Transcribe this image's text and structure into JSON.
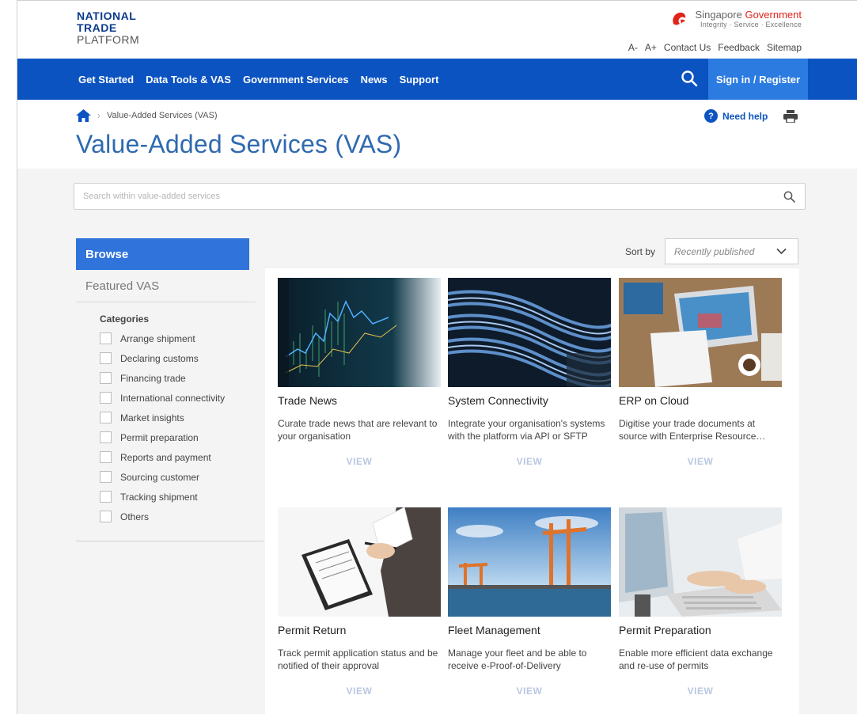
{
  "header": {
    "logo_lines": [
      "NATIONAL",
      "TRADE",
      "PLATFORM"
    ],
    "gov_prefix": "Singapore",
    "gov_suffix": "Government",
    "gov_tagline": "Integrity · Service · Excellence",
    "util_links": [
      "A-",
      "A+",
      "Contact Us",
      "Feedback",
      "Sitemap"
    ]
  },
  "nav": {
    "items": [
      "Get Started",
      "Data Tools & VAS",
      "Government Services",
      "News",
      "Support"
    ],
    "signin_label": "Sign in / Register"
  },
  "breadcrumb": {
    "current": "Value-Added Services (VAS)"
  },
  "help_label": "Need help",
  "page_title": "Value-Added Services (VAS)",
  "search": {
    "placeholder": "Search within value-added services"
  },
  "sidebar": {
    "browse_label": "Browse",
    "featured_label": "Featured VAS",
    "categories_title": "Categories",
    "categories": [
      "Arrange shipment",
      "Declaring customs",
      "Financing trade",
      "International connectivity",
      "Market insights",
      "Permit preparation",
      "Reports and payment",
      "Sourcing customer",
      "Tracking shipment",
      "Others"
    ]
  },
  "sort": {
    "label": "Sort by",
    "value": "Recently published"
  },
  "cards": [
    {
      "title": "Trade News",
      "desc": "Curate trade news that are relevant to your organisation",
      "view": "VIEW"
    },
    {
      "title": "System Connectivity",
      "desc": "Integrate your organisation's systems with the platform via API or SFTP",
      "view": "VIEW"
    },
    {
      "title": "ERP on Cloud",
      "desc": "Digitise your trade documents at source with Enterprise Resource…",
      "view": "VIEW"
    },
    {
      "title": "Permit Return",
      "desc": "Track permit application status and be notified of their approval",
      "view": "VIEW"
    },
    {
      "title": "Fleet Management",
      "desc": "Manage your fleet and be able to receive e-Proof-of-Delivery",
      "view": "VIEW"
    },
    {
      "title": "Permit Preparation",
      "desc": "Enable more efficient data exchange and re-use of permits",
      "view": "VIEW"
    }
  ],
  "colors": {
    "nav_bg": "#0b53c1",
    "signin_bg": "#2b7be0",
    "browse_bg": "#2f73db",
    "title_blue": "#2f6ab0",
    "gov_red": "#e2231a"
  }
}
